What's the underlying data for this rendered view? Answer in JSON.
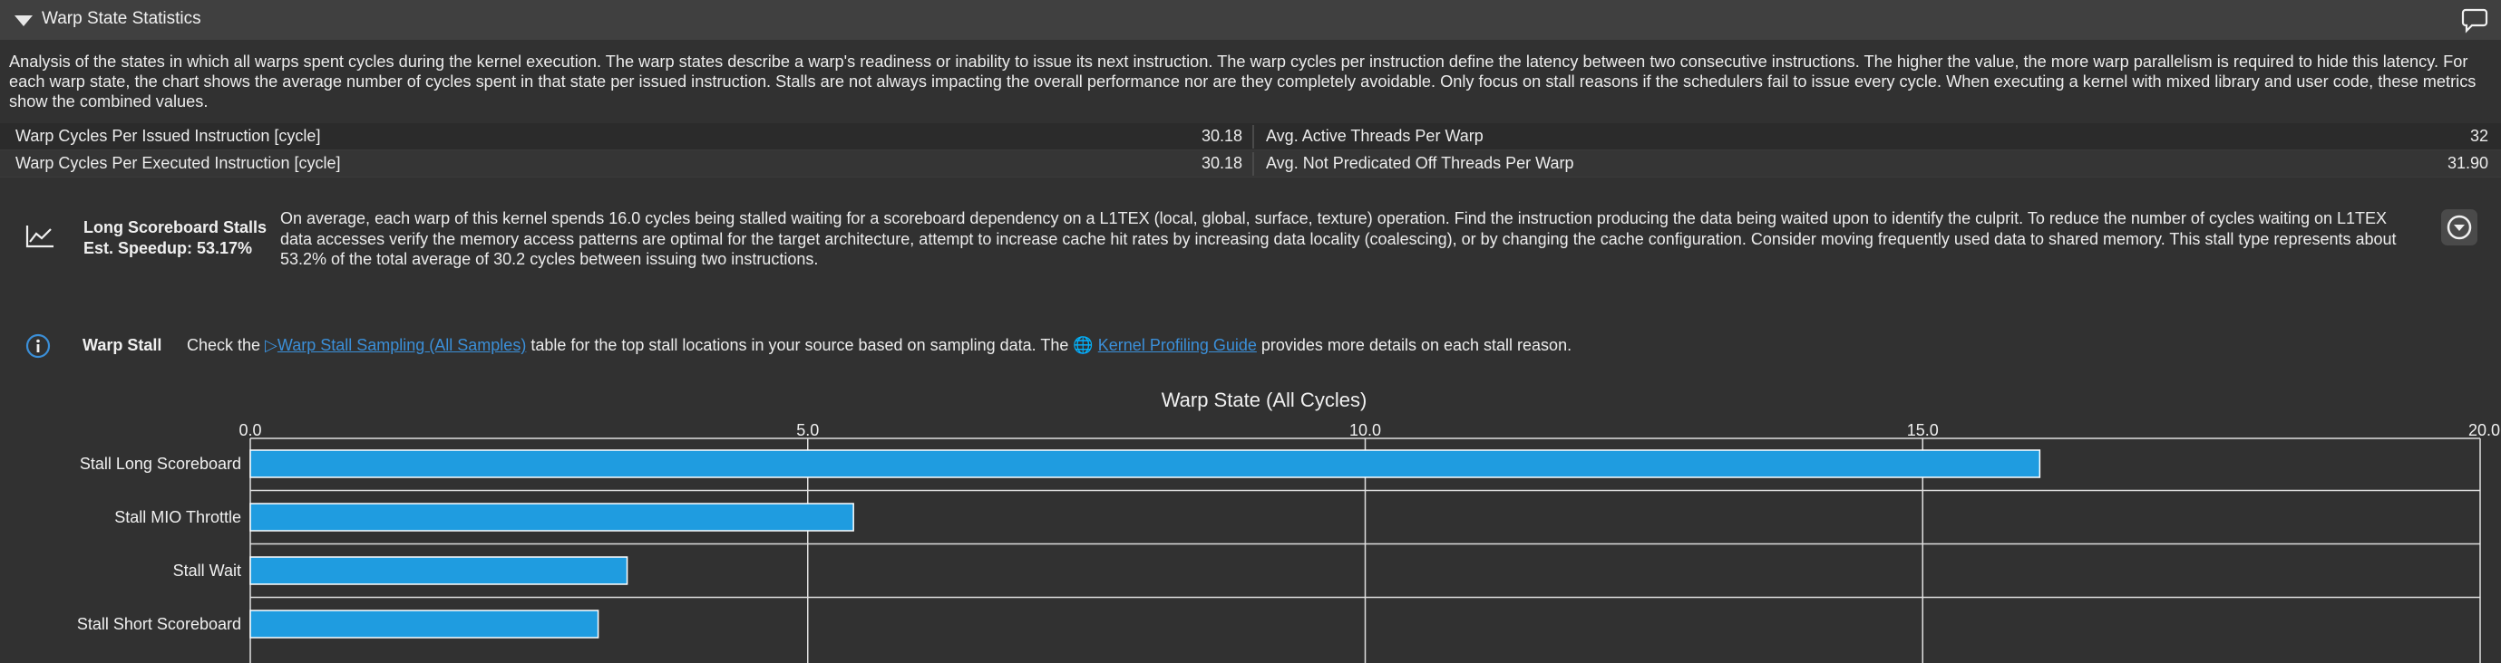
{
  "section": {
    "title": "Warp State Statistics",
    "description": "Analysis of the states in which all warps spent cycles during the kernel execution. The warp states describe a warp's readiness or inability to issue its next instruction. The warp cycles per instruction define the latency between two consecutive instructions. The higher the value, the more warp parallelism is required to hide this latency. For each warp state, the chart shows the average number of cycles spent in that state per issued instruction. Stalls are not always impacting the overall performance nor are they completely avoidable. Only focus on stall reasons if the schedulers fail to issue every cycle. When executing a kernel with mixed library and user code, these metrics show the combined values."
  },
  "metrics": [
    {
      "left_label": "Warp Cycles Per Issued Instruction [cycle]",
      "left_value": "30.18",
      "right_label": "Avg. Active Threads Per Warp",
      "right_value": "32"
    },
    {
      "left_label": "Warp Cycles Per Executed Instruction [cycle]",
      "left_value": "30.18",
      "right_label": "Avg. Not Predicated Off Threads Per Warp",
      "right_value": "31.90"
    }
  ],
  "stall_rule": {
    "icon": "line-chart-icon",
    "name": "Long Scoreboard Stalls",
    "speedup": "Est. Speedup: 53.17%",
    "text": "On average, each warp of this kernel spends 16.0 cycles being stalled waiting for a scoreboard dependency on a L1TEX (local, global, surface, texture) operation. Find the instruction producing the data being waited upon to identify the culprit. To reduce the number of cycles waiting on L1TEX data accesses verify the memory access patterns are optimal for the target architecture, attempt to increase cache hit rates by increasing data locality (coalescing), or by changing the cache configuration. Consider moving frequently used data to shared memory. This stall type represents about 53.2% of the total average of 30.2 cycles between issuing two instructions."
  },
  "warp_stall_hint": {
    "icon": "info-icon",
    "label": "Warp Stall",
    "prefix": "Check the ",
    "link1_glyph": "▷",
    "link1": "Warp Stall Sampling (All Samples)",
    "middle": " table for the top stall locations in your source based on sampling data. The ",
    "link2_glyph": "🌐",
    "link2": "Kernel Profiling Guide",
    "suffix": " provides more details on each stall reason."
  },
  "colors": {
    "bar": "#1f9ce0",
    "background": "#313131",
    "grid": "#e0e0e0",
    "link": "#3b8fd8"
  },
  "chart_data": {
    "type": "bar",
    "orientation": "horizontal",
    "title": "Warp State (All Cycles)",
    "xlim": [
      0,
      20
    ],
    "ticks": [
      "0.0",
      "5.0",
      "10.0",
      "15.0",
      "20.0"
    ],
    "tick_values": [
      0,
      5,
      10,
      15,
      20
    ],
    "categories": [
      "Stall Long Scoreboard",
      "Stall MIO Throttle",
      "Stall Wait",
      "Stall Short Scoreboard"
    ],
    "values": [
      16.05,
      5.41,
      3.38,
      3.12
    ],
    "grid": true
  }
}
